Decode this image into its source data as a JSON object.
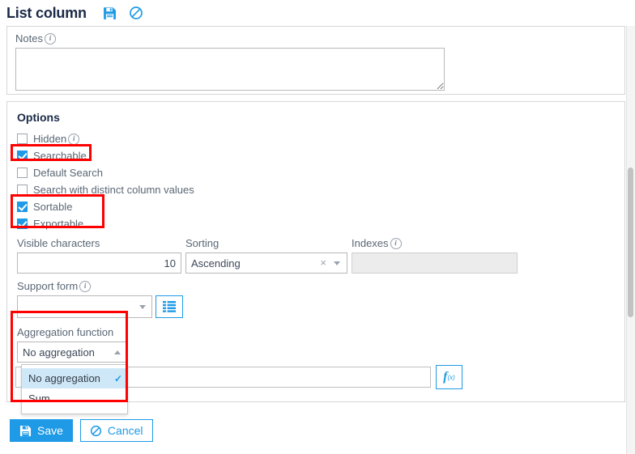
{
  "header": {
    "title": "List column",
    "save_icon": "floppy-disk-icon",
    "cancel_icon": "circle-slash-icon",
    "accent_color": "#1e9ae6"
  },
  "notes": {
    "label": "Notes",
    "info_glyph": "i",
    "value": "",
    "placeholder": ""
  },
  "options": {
    "title": "Options",
    "checkboxes": [
      {
        "label": "Hidden",
        "checked": false,
        "has_info": true,
        "highlighted": false
      },
      {
        "label": "Searchable",
        "checked": true,
        "has_info": false,
        "highlighted": true
      },
      {
        "label": "Default Search",
        "checked": false,
        "has_info": false,
        "highlighted": false
      },
      {
        "label": "Search with distinct column values",
        "checked": false,
        "has_info": false,
        "highlighted": false
      },
      {
        "label": "Sortable",
        "checked": true,
        "has_info": false,
        "highlighted": true
      },
      {
        "label": "Exportable",
        "checked": true,
        "has_info": false,
        "highlighted": true
      }
    ],
    "visible_characters": {
      "label": "Visible characters",
      "value": "10"
    },
    "sorting": {
      "label": "Sorting",
      "value": "Ascending",
      "clear_glyph": "×",
      "chevron": "chevron-down-icon"
    },
    "indexes": {
      "label": "Indexes",
      "value": "",
      "disabled": true,
      "has_info": true
    },
    "support_form": {
      "label": "Support form",
      "value": "",
      "has_info": true,
      "list_button_icon": "list-icon"
    },
    "aggregation": {
      "label": "Aggregation function",
      "value": "No aggregation",
      "expanded": true,
      "chevron": "chevron-up-icon",
      "options": [
        {
          "label": "No aggregation",
          "selected": true
        },
        {
          "label": "Sum",
          "selected": false
        }
      ],
      "check_glyph": "✓"
    },
    "formula": {
      "value": "",
      "placeholder": "",
      "button_f": "f",
      "button_x": "(x)",
      "button_icon": "formula-icon"
    }
  },
  "footer": {
    "save_label": "Save",
    "save_icon": "floppy-disk-icon",
    "cancel_label": "Cancel",
    "cancel_icon": "circle-slash-icon"
  }
}
